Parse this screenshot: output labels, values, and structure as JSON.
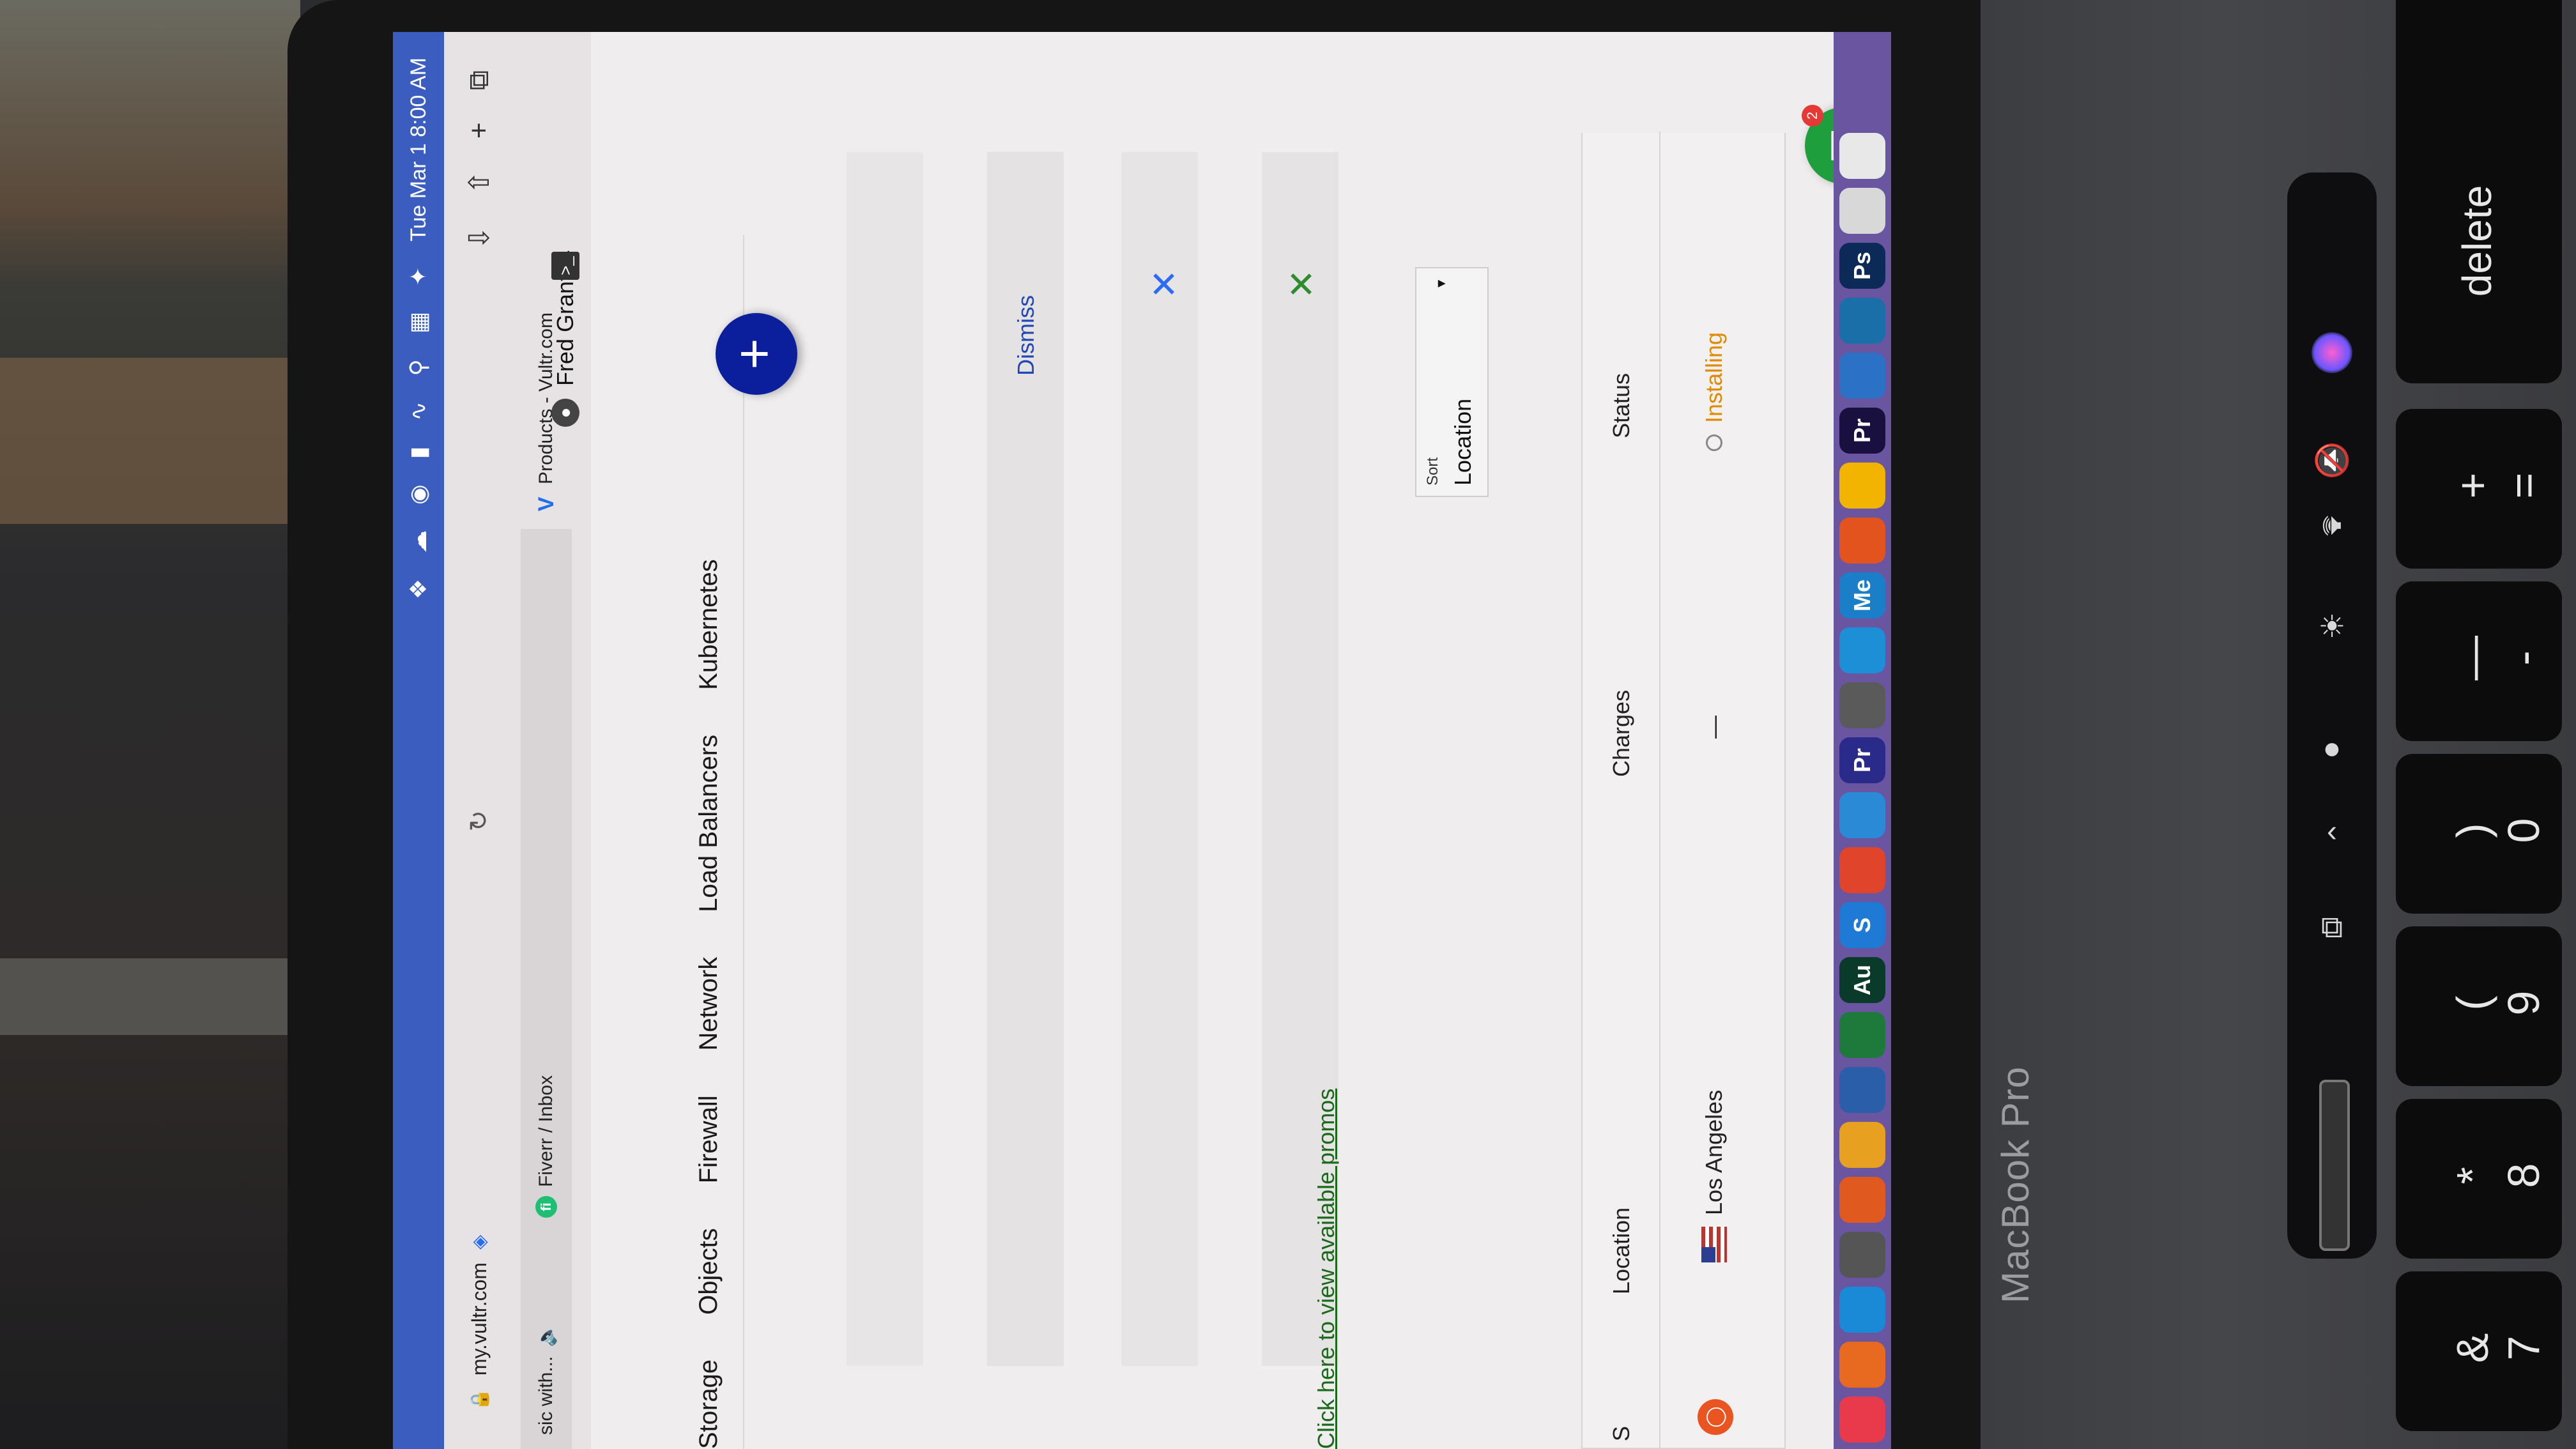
{
  "menubar": {
    "clock": "Tue Mar 1  8:00 AM",
    "icons": [
      "dropbox-icon",
      "creative-cloud-icon",
      "screen-record-icon",
      "battery-icon",
      "wifi-icon",
      "search-icon",
      "control-center-icon",
      "siri-icon"
    ]
  },
  "browser": {
    "url": "my.vultr.com",
    "tabs": [
      {
        "label": "sic with...",
        "favicon": "speaker-icon"
      },
      {
        "label": "Fiverr / Inbox",
        "favicon": "fiverr"
      },
      {
        "label": "Products - Vultr.com",
        "favicon": "vultr"
      }
    ]
  },
  "header": {
    "user_name": "Fred Grant"
  },
  "nav": {
    "items": [
      "Storage",
      "Objects",
      "Firewall",
      "Network",
      "Load Balancers",
      "Kubernetes"
    ]
  },
  "notices": {
    "dismiss_label": "Dismiss",
    "close_symbol": "✕",
    "promo_link": "Click here to view available promos"
  },
  "sort": {
    "label": "Sort",
    "value": "Location"
  },
  "table": {
    "headers": {
      "partial": "S",
      "location": "Location",
      "charges": "Charges",
      "status": "Status"
    },
    "rows": [
      {
        "location": "Los Angeles",
        "charges": "—",
        "status": "Installing",
        "os_icon": "ubuntu-icon",
        "flag": "us-flag"
      }
    ]
  },
  "chat": {
    "badge_count": "2"
  },
  "device": {
    "label": "MacBook Pro",
    "delete_key": "delete",
    "keys": [
      {
        "primary": "=",
        "secondary": "+"
      },
      {
        "primary": "-",
        "secondary": "—"
      },
      {
        "primary": "0",
        "secondary": ")"
      },
      {
        "primary": "9",
        "secondary": "("
      },
      {
        "primary": "8",
        "secondary": "*"
      },
      {
        "primary": "7",
        "secondary": "&"
      }
    ]
  },
  "dock": {
    "apps": [
      {
        "label": "",
        "color": "#e8e8e8"
      },
      {
        "label": "",
        "color": "#d8d8d8"
      },
      {
        "label": "Ps",
        "color": "#0b2a57"
      },
      {
        "label": "",
        "color": "#1a6fa8"
      },
      {
        "label": "",
        "color": "#2b72c6"
      },
      {
        "label": "Pr",
        "color": "#1a1040"
      },
      {
        "label": "",
        "color": "#f2b400"
      },
      {
        "label": "",
        "color": "#e2531e"
      },
      {
        "label": "Me",
        "color": "#1a7ec8"
      },
      {
        "label": "",
        "color": "#1c8fd6"
      },
      {
        "label": "",
        "color": "#5a5a5a"
      },
      {
        "label": "Pr",
        "color": "#2a2a8a"
      },
      {
        "label": "",
        "color": "#2a8ad6"
      },
      {
        "label": "",
        "color": "#e0442a"
      },
      {
        "label": "S",
        "color": "#1f7ad6"
      },
      {
        "label": "Au",
        "color": "#0a3b2a"
      },
      {
        "label": "",
        "color": "#1d7a3a"
      },
      {
        "label": "",
        "color": "#2b5ea8"
      },
      {
        "label": "",
        "color": "#e8a020"
      },
      {
        "label": "",
        "color": "#e05a20"
      },
      {
        "label": "",
        "color": "#555555"
      },
      {
        "label": "",
        "color": "#1a8ad6"
      },
      {
        "label": "",
        "color": "#e86a20"
      },
      {
        "label": "",
        "color": "#e83a4a"
      }
    ]
  }
}
